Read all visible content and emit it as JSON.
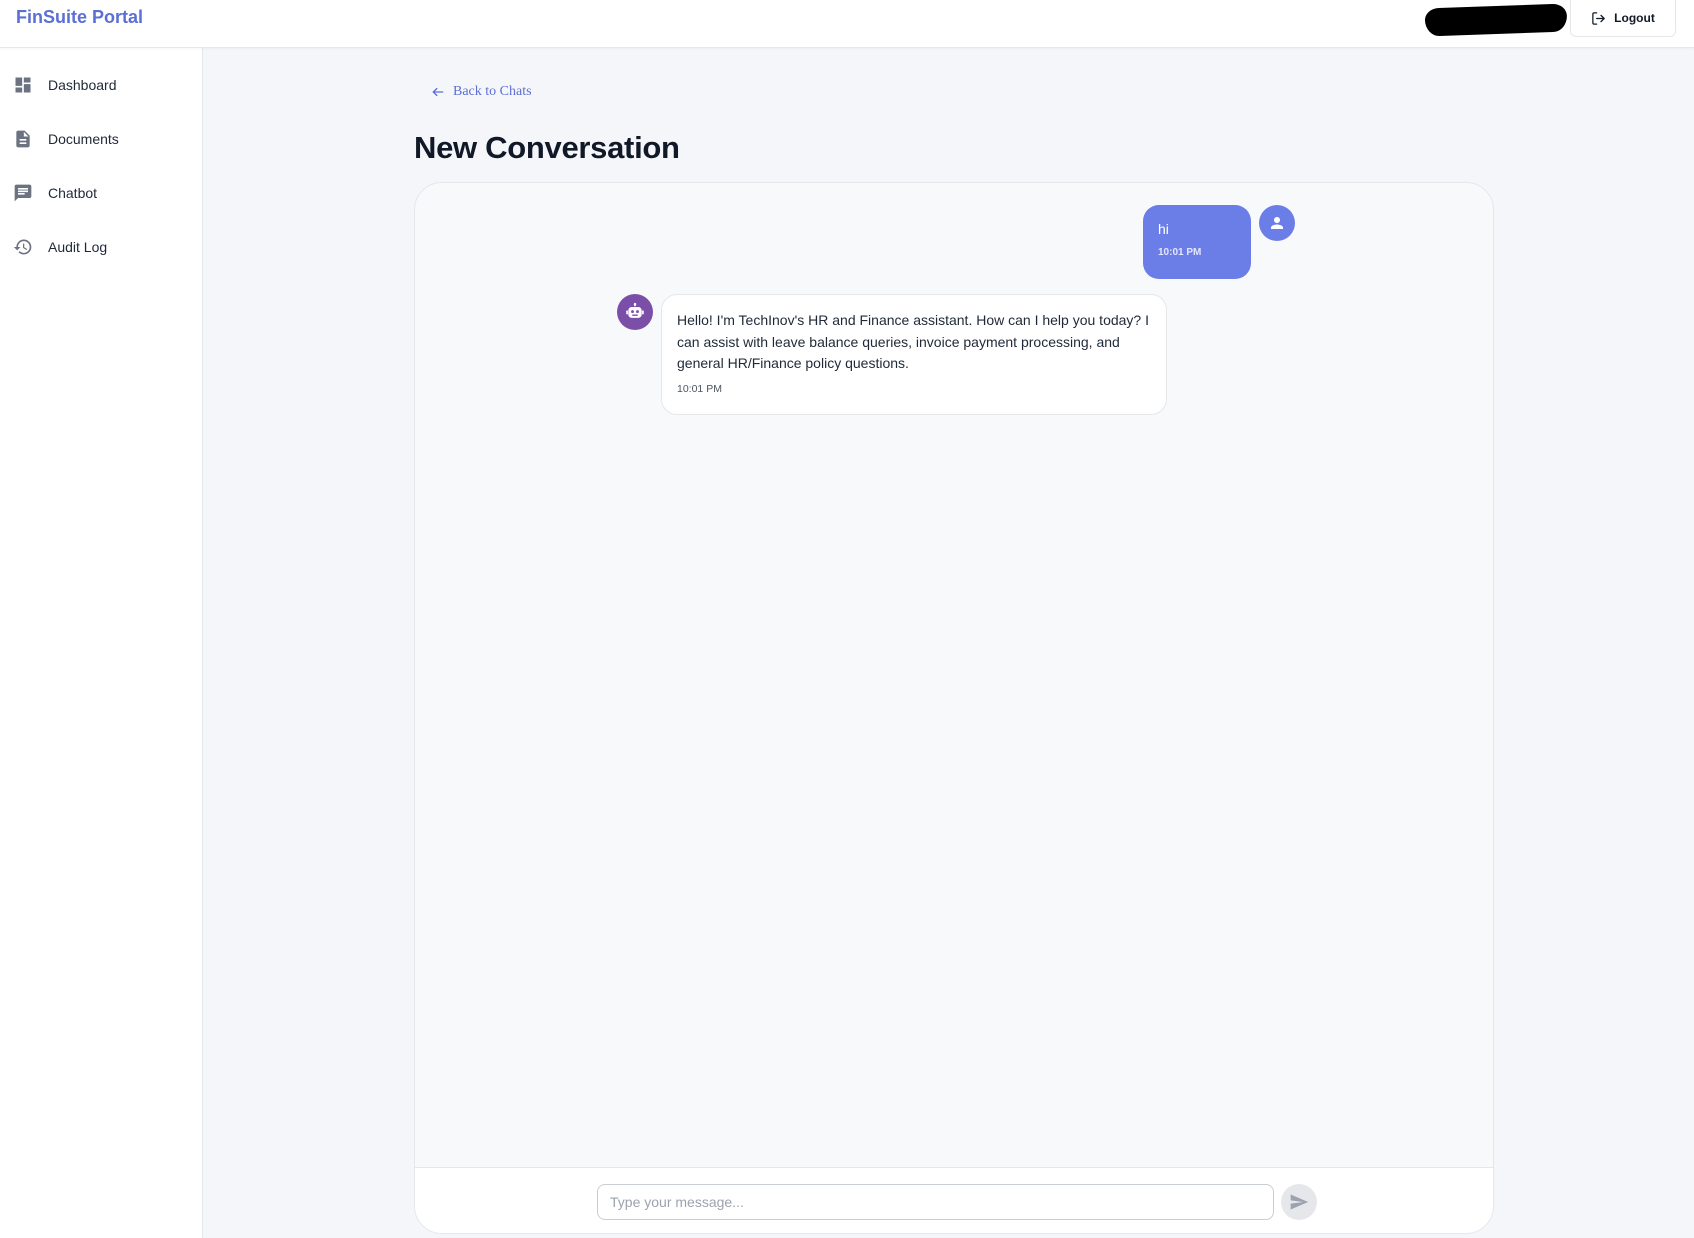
{
  "header": {
    "brand": "FinSuite Portal",
    "logout_label": "Logout"
  },
  "sidebar": {
    "items": [
      {
        "label": "Dashboard",
        "icon": "dashboard-icon"
      },
      {
        "label": "Documents",
        "icon": "document-icon"
      },
      {
        "label": "Chatbot",
        "icon": "chat-icon"
      },
      {
        "label": "Audit Log",
        "icon": "history-icon"
      }
    ]
  },
  "main": {
    "back_label": "Back to Chats",
    "title": "New Conversation"
  },
  "messages": [
    {
      "sender": "user",
      "text": "hi",
      "time": "10:01 PM"
    },
    {
      "sender": "bot",
      "text": "Hello! I'm TechInov's HR and Finance assistant. How can I help you today? I can assist with leave balance queries, invoice payment processing, and general HR/Finance policy questions.",
      "time": "10:01 PM"
    }
  ],
  "composer": {
    "placeholder": "Type your message...",
    "value": ""
  },
  "colors": {
    "accent": "#5b6fd6",
    "user_bubble": "#6b7ee8",
    "bot_avatar": "#7b4fa8"
  }
}
